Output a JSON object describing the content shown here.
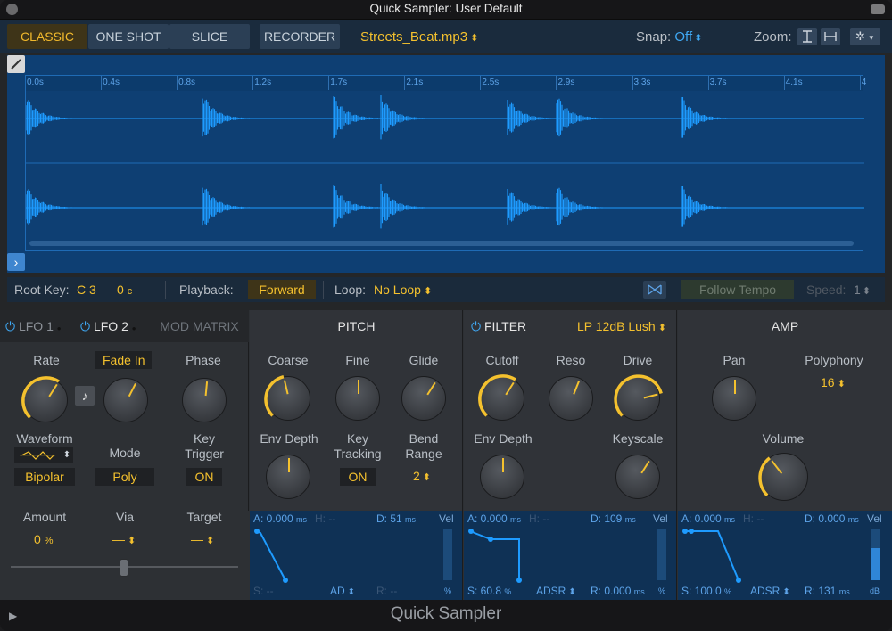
{
  "window": {
    "title": "Quick Sampler: User Default",
    "footer": "Quick Sampler"
  },
  "modes": {
    "classic": "CLASSIC",
    "oneshot": "ONE SHOT",
    "slice": "SLICE",
    "recorder": "RECORDER"
  },
  "file": {
    "name": "Streets_Beat.mp3",
    "arrow": "⌃⌄"
  },
  "snap": {
    "label": "Snap:",
    "value": "Off"
  },
  "zoom": {
    "label": "Zoom:"
  },
  "ruler": [
    "0.0s",
    "0.4s",
    "0.8s",
    "1.2s",
    "1.7s",
    "2.1s",
    "2.5s",
    "2.9s",
    "3.3s",
    "3.7s",
    "4.1s",
    "4"
  ],
  "info": {
    "root_key_label": "Root Key:",
    "root_key": "C 3",
    "cents": "0",
    "cents_unit": "c",
    "playback_label": "Playback:",
    "playback": "Forward",
    "loop_label": "Loop:",
    "loop": "No Loop",
    "follow_tempo": "Follow Tempo",
    "speed_label": "Speed:",
    "speed": "1"
  },
  "lfo": {
    "tab1": "LFO 1",
    "tab2": "LFO 2",
    "tab3": "MOD MATRIX",
    "rate": "Rate",
    "fade_in": "Fade In",
    "phase": "Phase",
    "waveform": "Waveform",
    "mode": "Mode",
    "key_trigger": "Key Trigger",
    "bipolar": "Bipolar",
    "poly": "Poly",
    "on": "ON",
    "amount": "Amount",
    "amount_value": "0",
    "amount_unit": "%",
    "via": "Via",
    "via_value": "—",
    "target": "Target",
    "target_value": "—"
  },
  "pitch": {
    "title": "PITCH",
    "coarse": "Coarse",
    "fine": "Fine",
    "glide": "Glide",
    "env_depth": "Env Depth",
    "key_tracking": "Key Tracking",
    "key_tracking_value": "ON",
    "bend_range": "Bend Range",
    "bend_range_value": "2",
    "env": {
      "a": "A: 0.000",
      "a_unit": "ms",
      "h": "H: --",
      "d": "D: 51",
      "d_unit": "ms",
      "vel": "Vel",
      "s": "S: --",
      "mode": "AD",
      "r": "R: --",
      "pct": "%"
    }
  },
  "filter": {
    "title": "FILTER",
    "type": "LP 12dB Lush",
    "cutoff": "Cutoff",
    "reso": "Reso",
    "drive": "Drive",
    "env_depth": "Env Depth",
    "keyscale": "Keyscale",
    "env": {
      "a": "A: 0.000",
      "a_unit": "ms",
      "h": "H: --",
      "d": "D: 109",
      "d_unit": "ms",
      "vel": "Vel",
      "s": "S: 60.8",
      "s_unit": "%",
      "mode": "ADSR",
      "r": "R: 0.000",
      "r_unit": "ms",
      "pct": "%"
    }
  },
  "amp": {
    "title": "AMP",
    "pan": "Pan",
    "polyphony": "Polyphony",
    "polyphony_value": "16",
    "volume": "Volume",
    "env": {
      "a": "A: 0.000",
      "a_unit": "ms",
      "h": "H: --",
      "d": "D: 0.000",
      "d_unit": "ms",
      "vel": "Vel",
      "s": "S: 100.0",
      "s_unit": "%",
      "mode": "ADSR",
      "r": "R: 131",
      "r_unit": "ms",
      "db": "dB"
    }
  },
  "colors": {
    "accent_yellow": "#f4c12e",
    "accent_blue": "#3fa9f5",
    "wave": "#1e9bff"
  }
}
